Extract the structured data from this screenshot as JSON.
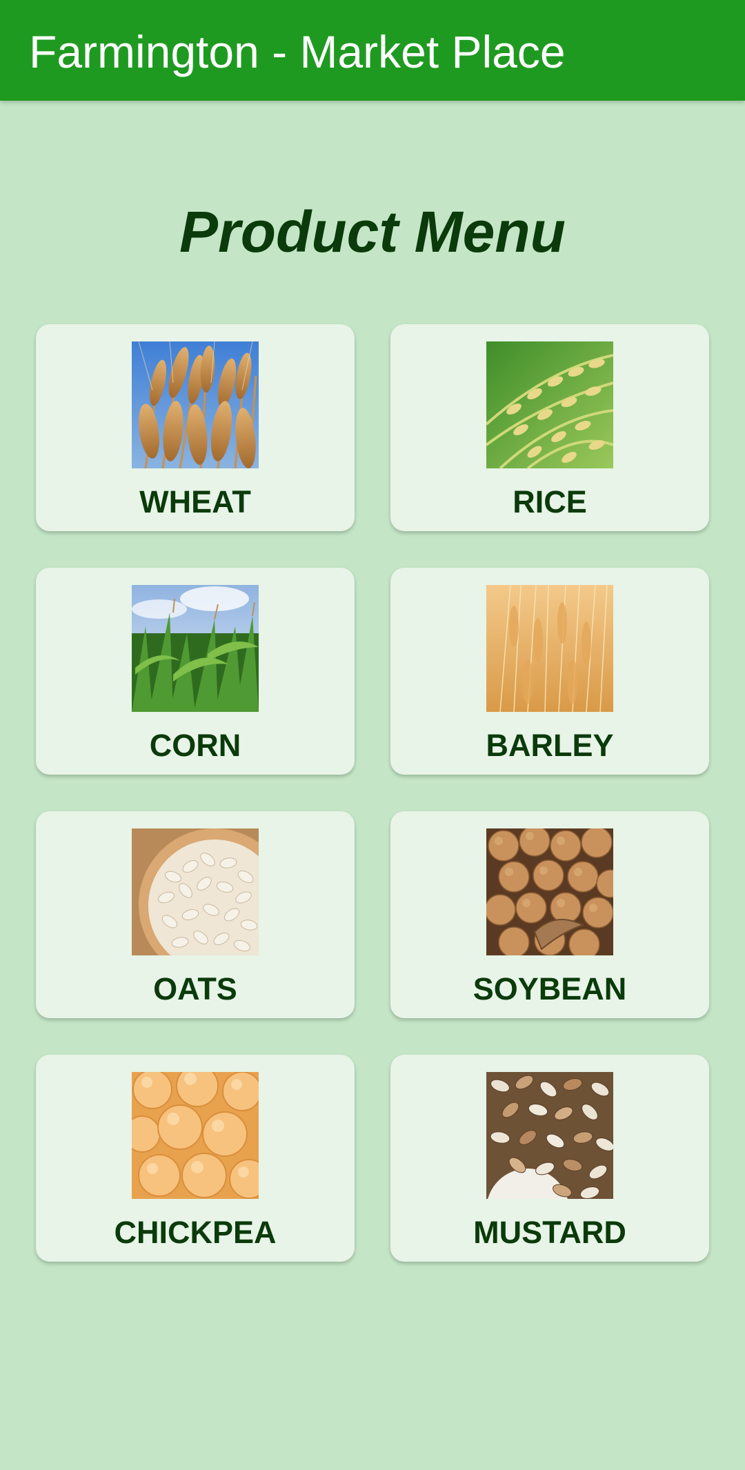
{
  "appbar": {
    "title": "Farmington - Market Place",
    "color": "#1f9a21"
  },
  "page": {
    "title": "Product Menu",
    "background": "#c4e6c6"
  },
  "products": [
    {
      "label": "WHEAT",
      "image": "wheat-image"
    },
    {
      "label": "RICE",
      "image": "rice-image"
    },
    {
      "label": "CORN",
      "image": "corn-image"
    },
    {
      "label": "BARLEY",
      "image": "barley-image"
    },
    {
      "label": "OATS",
      "image": "oats-image"
    },
    {
      "label": "SOYBEAN",
      "image": "soybean-image"
    },
    {
      "label": "CHICKPEA",
      "image": "chickpea-image"
    },
    {
      "label": "MUSTARD",
      "image": "mustard-image"
    }
  ]
}
